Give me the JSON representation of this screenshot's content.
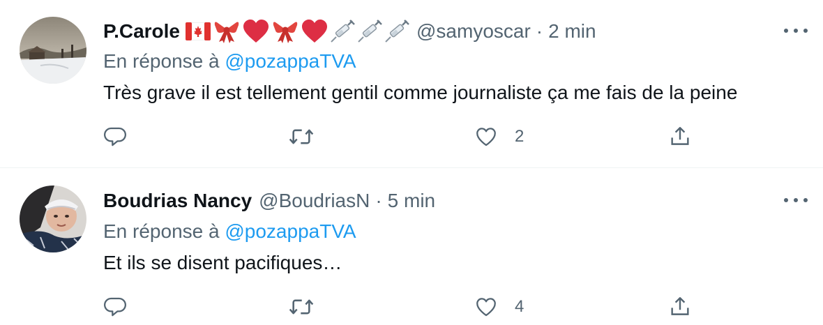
{
  "tweets": [
    {
      "author": {
        "name": "P.Carole",
        "name_emojis": [
          "canada-flag",
          "ribbon",
          "red-heart",
          "ribbon",
          "red-heart",
          "syringe",
          "syringe",
          "syringe"
        ],
        "handle": "@samyoscar",
        "time": "2 min"
      },
      "reply_prefix": "En réponse à",
      "reply_to": "@pozappaTVA",
      "text": "Très grave il est tellement gentil comme journaliste ça me fais de la peine",
      "like_count": "2"
    },
    {
      "author": {
        "name": "Boudrias Nancy",
        "handle": "@BoudriasN",
        "time": "5 min"
      },
      "reply_prefix": "En réponse à",
      "reply_to": "@pozappaTVA",
      "text": "Et ils se disent pacifiques…",
      "like_count": "4"
    }
  ],
  "separator": "·",
  "colors": {
    "text": "#0f1419",
    "secondary": "#536471",
    "link": "#1d9bf0",
    "divider": "#eff3f4"
  }
}
